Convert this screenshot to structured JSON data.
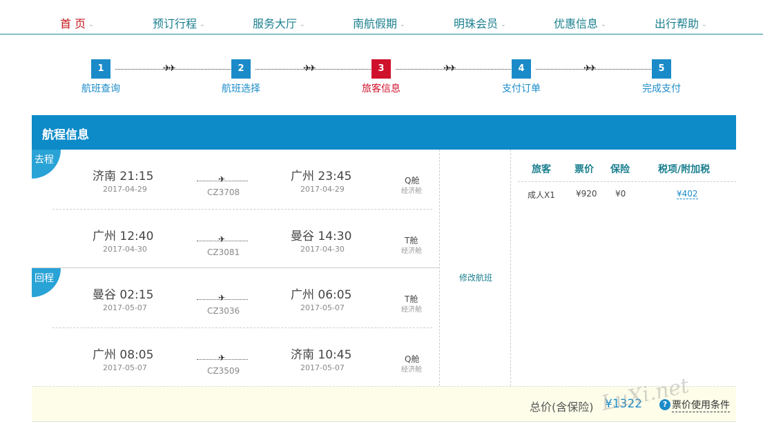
{
  "nav": {
    "items": [
      {
        "label": "首 页",
        "active": true
      },
      {
        "label": "预订行程",
        "active": false
      },
      {
        "label": "服务大厅",
        "active": false
      },
      {
        "label": "南航假期",
        "active": false
      },
      {
        "label": "明珠会员",
        "active": false
      },
      {
        "label": "优惠信息",
        "active": false
      },
      {
        "label": "出行帮助",
        "active": false
      }
    ],
    "caret": "⌄"
  },
  "steps": [
    {
      "num": "1",
      "label": "航班查询"
    },
    {
      "num": "2",
      "label": "航班选择"
    },
    {
      "num": "3",
      "label": "旅客信息"
    },
    {
      "num": "4",
      "label": "支付订单"
    },
    {
      "num": "5",
      "label": "完成支付"
    }
  ],
  "current_step": 3,
  "card": {
    "title": "航程信息",
    "segments": [
      {
        "tag": "去程",
        "flights": [
          {
            "dep": "济南 21:15",
            "dep_date": "2017-04-29",
            "arr": "广州 23:45",
            "arr_date": "2017-04-29",
            "flight_no": "CZ3708",
            "cabin": "Q舱",
            "class": "经济舱"
          },
          {
            "dep": "广州 12:40",
            "dep_date": "2017-04-30",
            "arr": "曼谷 14:30",
            "arr_date": "2017-04-30",
            "flight_no": "CZ3081",
            "cabin": "T舱",
            "class": "经济舱"
          }
        ]
      },
      {
        "tag": "回程",
        "flights": [
          {
            "dep": "曼谷 02:15",
            "dep_date": "2017-05-07",
            "arr": "广州 06:05",
            "arr_date": "2017-05-07",
            "flight_no": "CZ3036",
            "cabin": "T舱",
            "class": "经济舱"
          },
          {
            "dep": "广州 08:05",
            "dep_date": "2017-05-07",
            "arr": "济南 10:45",
            "arr_date": "2017-05-07",
            "flight_no": "CZ3509",
            "cabin": "Q舱",
            "class": "经济舱"
          }
        ]
      }
    ],
    "modify_label": "修改航班",
    "price_table": {
      "headers": [
        "旅客",
        "票价",
        "保险",
        "税项/附加税"
      ],
      "rows": [
        {
          "passenger": "成人X1",
          "fare": "¥920",
          "insurance": "¥0",
          "tax": "¥402"
        }
      ]
    },
    "total": {
      "label": "总价(含保险)",
      "value": "¥1322",
      "help_icon": "?",
      "terms_label": "票价使用条件"
    }
  },
  "watermark": "LuXi.net",
  "colors": {
    "accent": "#0d8ac8",
    "current": "#d0112b",
    "nav_active": "#c4161c"
  }
}
